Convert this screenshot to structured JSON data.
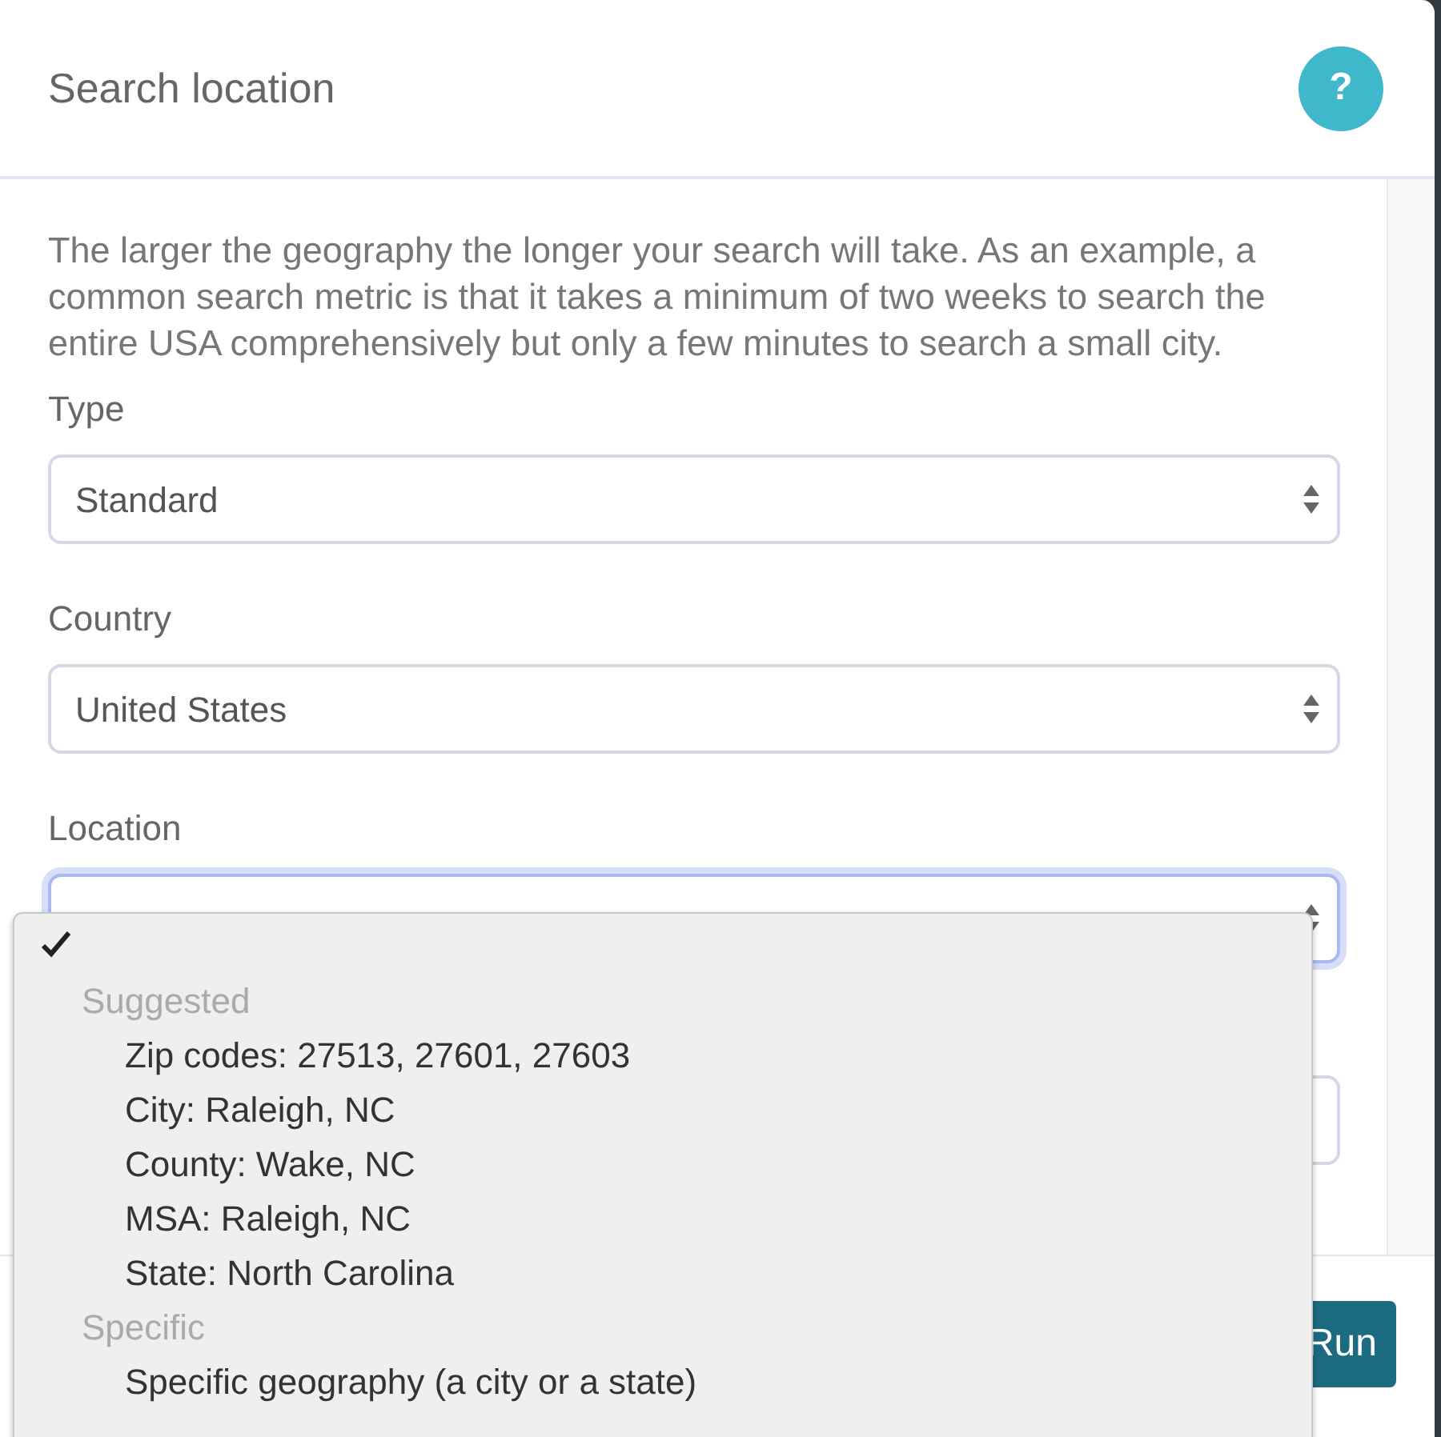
{
  "modal": {
    "title": "Search location",
    "help_icon": "?"
  },
  "intro": "The larger the geography the longer your search will take. As an example, a common search metric is that it takes a minimum of two weeks to search the entire USA comprehensively but only a few minutes to search a small city.",
  "fields": [
    {
      "label": "Type",
      "value": "Standard",
      "focused": false
    },
    {
      "label": "Country",
      "value": "United States",
      "focused": false
    },
    {
      "label": "Location",
      "focused": true
    }
  ],
  "location_dropdown": {
    "blank_option": {
      "selected": true
    },
    "groups": [
      {
        "label": "Suggested",
        "options": [
          {
            "label": "Zip codes: 27513, 27601, 27603",
            "selected": false
          },
          {
            "label": "City: Raleigh, NC",
            "selected": false
          },
          {
            "label": "County: Wake, NC",
            "selected": false
          },
          {
            "label": "MSA: Raleigh, NC",
            "selected": false
          },
          {
            "label": "State: North Carolina",
            "selected": false
          }
        ]
      },
      {
        "label": "Specific",
        "options": [
          {
            "label": "Specific geography (a city or a state)",
            "selected": false
          }
        ]
      }
    ]
  },
  "footer": {
    "run_button": "Run"
  }
}
